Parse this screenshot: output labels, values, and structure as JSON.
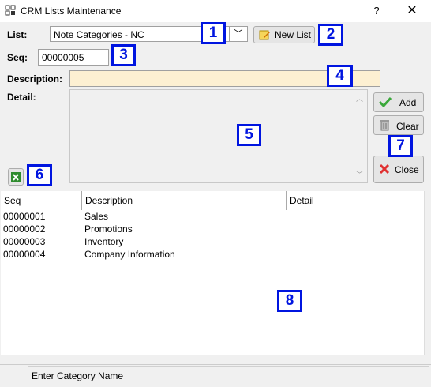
{
  "window": {
    "title": "CRM Lists Maintenance",
    "help": "?",
    "close": "✕"
  },
  "form": {
    "list_label": "List:",
    "list_value": "Note Categories - NC",
    "new_list_label": "New List",
    "seq_label": "Seq:",
    "seq_value": "00000005",
    "description_label": "Description:",
    "description_value": "",
    "detail_label": "Detail:",
    "detail_value": ""
  },
  "buttons": {
    "add": "Add",
    "clear": "Clear",
    "close": "Close"
  },
  "badges": [
    "1",
    "2",
    "3",
    "4",
    "5",
    "6",
    "7",
    "8"
  ],
  "grid": {
    "columns": [
      "Seq",
      "Description",
      "Detail"
    ],
    "rows": [
      [
        "00000001",
        "Sales",
        ""
      ],
      [
        "00000002",
        "Promotions",
        ""
      ],
      [
        "00000003",
        "Inventory",
        ""
      ],
      [
        "00000004",
        "Company Information",
        ""
      ]
    ]
  },
  "status": {
    "text": "Enter Category Name"
  },
  "colors": {
    "accent": "#0015e0",
    "description_bg": "#fdf0d2"
  }
}
